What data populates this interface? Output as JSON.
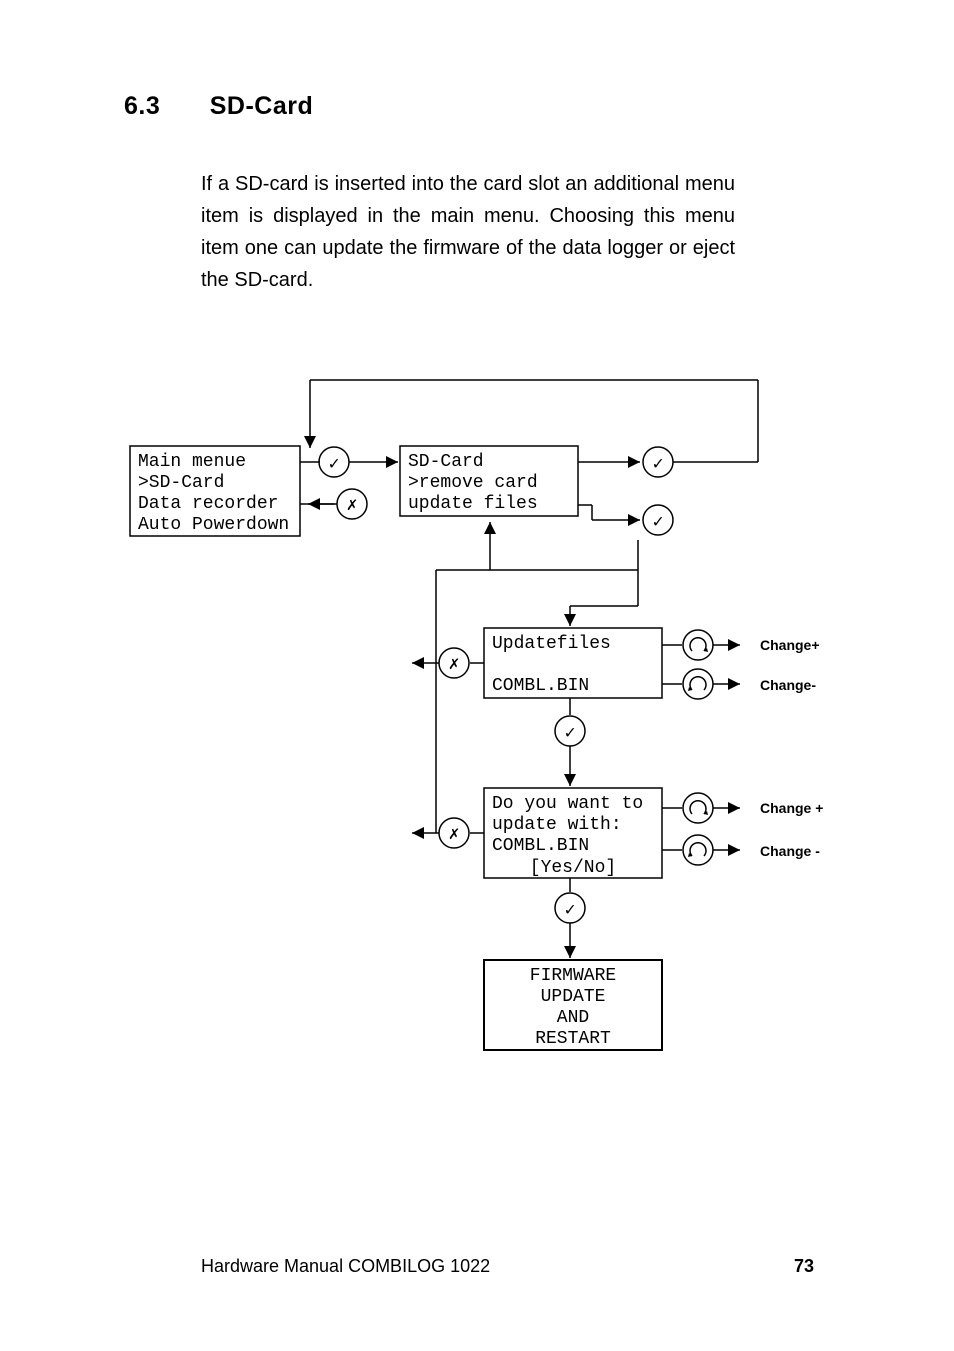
{
  "heading": {
    "number": "6.3",
    "title": "SD-Card"
  },
  "body_paragraph": "If a SD-card is inserted into the card slot an additional menu item is displayed in the main menu. Choosing this menu item one can update the firmware of the data logger or eject the SD-card.",
  "flow": {
    "main_menu": {
      "line1": "Main menue",
      "line2": ">SD-Card",
      "line3": " Data recorder",
      "line4": " Auto Powerdown"
    },
    "sd_card_menu": {
      "line1": "SD-Card",
      "line2": ">remove card",
      "line3": " update files"
    },
    "updatefiles": {
      "line1": "Updatefiles",
      "line2": "COMBL.BIN"
    },
    "confirm": {
      "line1": "Do you want to",
      "line2": "update with:",
      "line3": "COMBL.BIN",
      "line4": "[Yes/No]"
    },
    "final": {
      "line1": "FIRMWARE",
      "line2": "UPDATE",
      "line3": "AND",
      "line4": "RESTART"
    },
    "labels": {
      "change_plus_1": "Change+",
      "change_minus_1": "Change-",
      "change_plus_2": "Change +",
      "change_minus_2": "Change -"
    }
  },
  "footer": "Hardware Manual COMBILOG 1022",
  "page_number": "73"
}
